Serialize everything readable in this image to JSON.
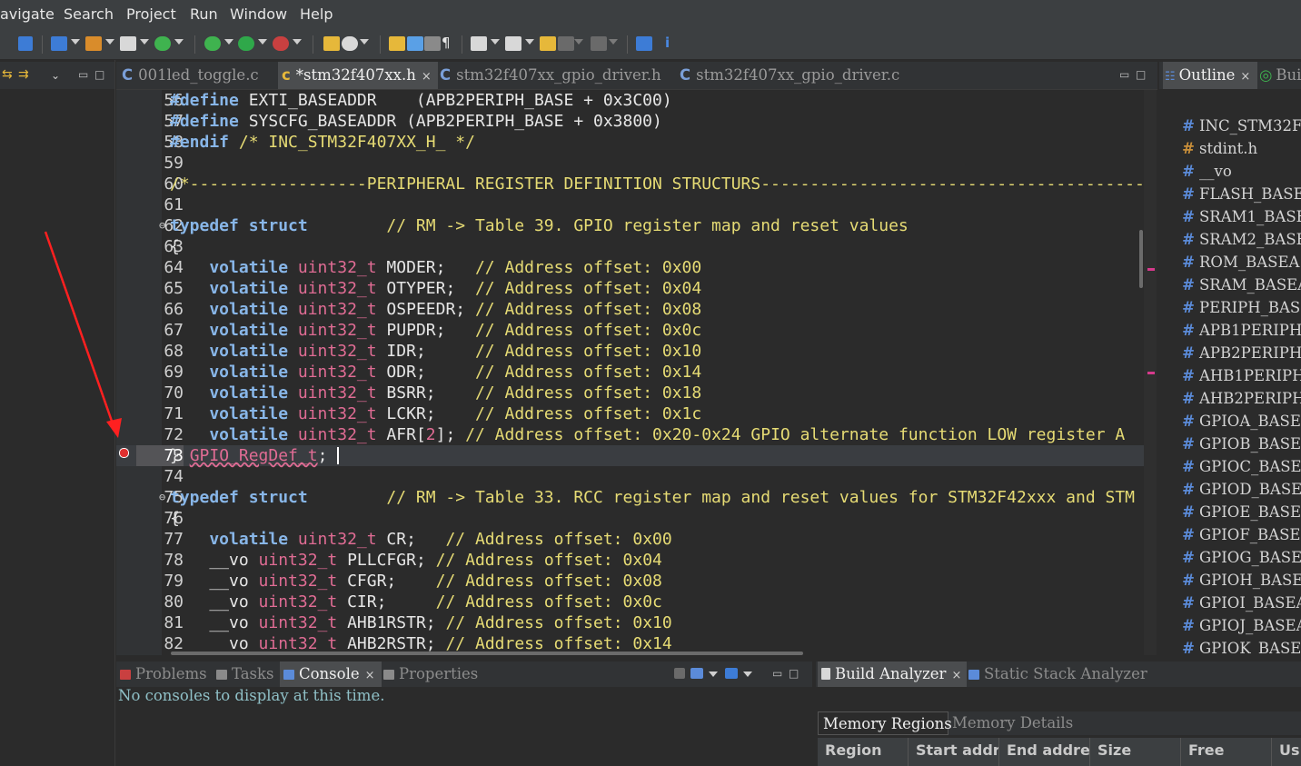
{
  "menu": [
    "avigate",
    "Search",
    "Project",
    "Run",
    "Window",
    "Help"
  ],
  "editor_tabs": [
    {
      "label": "001led_toggle.c",
      "icon": "c-file-icon",
      "active": false
    },
    {
      "label": "*stm32f407xx.h",
      "icon": "h-file-icon",
      "active": true,
      "close": "×"
    },
    {
      "label": "stm32f407xx_gpio_driver.h",
      "icon": "c-file-icon",
      "active": false
    },
    {
      "label": "stm32f407xx_gpio_driver.c",
      "icon": "c-file-icon",
      "active": false
    }
  ],
  "code": {
    "lines": [
      {
        "n": "56",
        "segs": [
          [
            "pp",
            "#define"
          ],
          [
            "mc",
            " EXTI_BASEADDR    (APB2PERIPH_BASE + 0x3C00)"
          ]
        ]
      },
      {
        "n": "57",
        "segs": [
          [
            "pp",
            "#define"
          ],
          [
            "mc",
            " SYSCFG_BASEADDR (APB2PERIPH_BASE + 0x3800)"
          ]
        ]
      },
      {
        "n": "58",
        "segs": [
          [
            "pp",
            "#endif"
          ],
          [
            "cm",
            " /* INC_STM32F407XX_H_ */"
          ]
        ]
      },
      {
        "n": "59",
        "segs": []
      },
      {
        "n": "60",
        "segs": [
          [
            "cm",
            "/*------------------PERIPHERAL REGISTER DEFINITION STRUCTURS--------------------------------------------"
          ]
        ]
      },
      {
        "n": "61",
        "segs": []
      },
      {
        "n": "62",
        "fold": true,
        "segs": [
          [
            "kw",
            "typedef struct"
          ],
          [
            "cm",
            "        // RM -> Table 39. GPIO register map and reset values"
          ]
        ]
      },
      {
        "n": "63",
        "segs": [
          [
            "mc",
            "{"
          ]
        ]
      },
      {
        "n": "64",
        "segs": [
          [
            "kw",
            "    volatile"
          ],
          [
            "ty",
            " uint32_t"
          ],
          [
            "mc",
            " MODER;   "
          ],
          [
            "cm",
            "// Address offset: 0x00"
          ]
        ]
      },
      {
        "n": "65",
        "segs": [
          [
            "kw",
            "    volatile"
          ],
          [
            "ty",
            " uint32_t"
          ],
          [
            "mc",
            " OTYPER;  "
          ],
          [
            "cm",
            "// Address offset: 0x04"
          ]
        ]
      },
      {
        "n": "66",
        "segs": [
          [
            "kw",
            "    volatile"
          ],
          [
            "ty",
            " uint32_t"
          ],
          [
            "mc",
            " OSPEEDR; "
          ],
          [
            "cm",
            "// Address offset: 0x08"
          ]
        ]
      },
      {
        "n": "67",
        "segs": [
          [
            "kw",
            "    volatile"
          ],
          [
            "ty",
            " uint32_t"
          ],
          [
            "mc",
            " PUPDR;   "
          ],
          [
            "cm",
            "// Address offset: 0x0c"
          ]
        ]
      },
      {
        "n": "68",
        "segs": [
          [
            "kw",
            "    volatile"
          ],
          [
            "ty",
            " uint32_t"
          ],
          [
            "mc",
            " IDR;     "
          ],
          [
            "cm",
            "// Address offset: 0x10"
          ]
        ]
      },
      {
        "n": "69",
        "segs": [
          [
            "kw",
            "    volatile"
          ],
          [
            "ty",
            " uint32_t"
          ],
          [
            "mc",
            " ODR;     "
          ],
          [
            "cm",
            "// Address offset: 0x14"
          ]
        ]
      },
      {
        "n": "70",
        "segs": [
          [
            "kw",
            "    volatile"
          ],
          [
            "ty",
            " uint32_t"
          ],
          [
            "mc",
            " BSRR;    "
          ],
          [
            "cm",
            "// Address offset: 0x18"
          ]
        ]
      },
      {
        "n": "71",
        "segs": [
          [
            "kw",
            "    volatile"
          ],
          [
            "ty",
            " uint32_t"
          ],
          [
            "mc",
            " LCKR;    "
          ],
          [
            "cm",
            "// Address offset: 0x1c"
          ]
        ]
      },
      {
        "n": "72",
        "segs": [
          [
            "kw",
            "    volatile"
          ],
          [
            "ty",
            " uint32_t"
          ],
          [
            "mc",
            " AFR["
          ],
          [
            "ty",
            "2"
          ],
          [
            "mc",
            "]; "
          ],
          [
            "cm",
            "// Address offset: 0x20-0x24 GPIO alternate function LOW register A"
          ]
        ]
      },
      {
        "n": "73",
        "current": true,
        "segs": [
          [
            "mc",
            "} "
          ],
          [
            "err",
            "GPIO_RegDef_t"
          ],
          [
            "mc",
            "; "
          ]
        ]
      },
      {
        "n": "74",
        "segs": []
      },
      {
        "n": "75",
        "fold": true,
        "segs": [
          [
            "kw",
            "typedef struct"
          ],
          [
            "cm",
            "        // RM -> Table 33. RCC register map and reset values for STM32F42xxx and STM"
          ]
        ]
      },
      {
        "n": "76",
        "segs": [
          [
            "mc",
            "{"
          ]
        ]
      },
      {
        "n": "77",
        "segs": [
          [
            "kw",
            "    volatile"
          ],
          [
            "ty",
            " uint32_t"
          ],
          [
            "mc",
            " CR;   "
          ],
          [
            "cm",
            "// Address offset: 0x00"
          ]
        ]
      },
      {
        "n": "78",
        "segs": [
          [
            "mc",
            "    __vo"
          ],
          [
            "ty",
            " uint32_t"
          ],
          [
            "mc",
            " PLLCFGR; "
          ],
          [
            "cm",
            "// Address offset: 0x04"
          ]
        ]
      },
      {
        "n": "79",
        "segs": [
          [
            "mc",
            "    __vo"
          ],
          [
            "ty",
            " uint32_t"
          ],
          [
            "mc",
            " CFGR;    "
          ],
          [
            "cm",
            "// Address offset: 0x08"
          ]
        ]
      },
      {
        "n": "80",
        "segs": [
          [
            "mc",
            "    __vo"
          ],
          [
            "ty",
            " uint32_t"
          ],
          [
            "mc",
            " CIR;     "
          ],
          [
            "cm",
            "// Address offset: 0x0c"
          ]
        ]
      },
      {
        "n": "81",
        "segs": [
          [
            "mc",
            "    __vo"
          ],
          [
            "ty",
            " uint32_t"
          ],
          [
            "mc",
            " AHB1RSTR; "
          ],
          [
            "cm",
            "// Address offset: 0x10"
          ]
        ]
      },
      {
        "n": "82",
        "segs": [
          [
            "mc",
            "    __vo"
          ],
          [
            "ty",
            " uint32_t"
          ],
          [
            "mc",
            " AHB2RSTR; "
          ],
          [
            "cm",
            "// Address offset: 0x14"
          ]
        ]
      }
    ]
  },
  "outline": {
    "tabs": [
      {
        "label": "Outline",
        "close": "×",
        "active": true
      },
      {
        "label": "Bui",
        "active": false
      }
    ],
    "items": [
      {
        "label": "INC_STM32F",
        "kind": "macro"
      },
      {
        "label": "stdint.h",
        "kind": "include"
      },
      {
        "label": "__vo",
        "kind": "macro"
      },
      {
        "label": "FLASH_BASE",
        "kind": "macro"
      },
      {
        "label": "SRAM1_BASE",
        "kind": "macro"
      },
      {
        "label": "SRAM2_BASE",
        "kind": "macro"
      },
      {
        "label": "ROM_BASEA",
        "kind": "macro"
      },
      {
        "label": "SRAM_BASEA",
        "kind": "macro"
      },
      {
        "label": "PERIPH_BAS",
        "kind": "macro"
      },
      {
        "label": "APB1PERIPH",
        "kind": "macro"
      },
      {
        "label": "APB2PERIPH",
        "kind": "macro"
      },
      {
        "label": "AHB1PERIPH",
        "kind": "macro"
      },
      {
        "label": "AHB2PERIPH",
        "kind": "macro"
      },
      {
        "label": "GPIOA_BASE",
        "kind": "macro"
      },
      {
        "label": "GPIOB_BASE",
        "kind": "macro"
      },
      {
        "label": "GPIOC_BASE",
        "kind": "macro"
      },
      {
        "label": "GPIOD_BASE",
        "kind": "macro"
      },
      {
        "label": "GPIOE_BASE",
        "kind": "macro"
      },
      {
        "label": "GPIOF_BASE",
        "kind": "macro"
      },
      {
        "label": "GPIOG_BASE",
        "kind": "macro"
      },
      {
        "label": "GPIOH_BASE",
        "kind": "macro"
      },
      {
        "label": "GPIOI_BASEA",
        "kind": "macro"
      },
      {
        "label": "GPIOJ_BASEA",
        "kind": "macro"
      },
      {
        "label": "GPIOK_BASE",
        "kind": "macro"
      }
    ]
  },
  "bottom_left": {
    "tabs": [
      {
        "label": "Problems",
        "active": false
      },
      {
        "label": "Tasks",
        "active": false
      },
      {
        "label": "Console",
        "active": true,
        "close": "×"
      },
      {
        "label": "Properties",
        "active": false
      }
    ],
    "message": "No consoles to display at this time."
  },
  "bottom_right": {
    "tabs": [
      {
        "label": "Build Analyzer",
        "active": true,
        "close": "×"
      },
      {
        "label": "Static Stack Analyzer",
        "active": false
      }
    ],
    "subtabs": [
      {
        "label": "Memory Regions",
        "active": true
      },
      {
        "label": "Memory Details",
        "active": false
      }
    ],
    "columns": [
      "Region",
      "Start addr",
      "End addre",
      "Size",
      "Free",
      "Us"
    ]
  },
  "colors": {
    "keyword": "#88b6e8",
    "type": "#e06c94",
    "comment": "#e6db74",
    "annotation_arrow": "#ff2020"
  }
}
